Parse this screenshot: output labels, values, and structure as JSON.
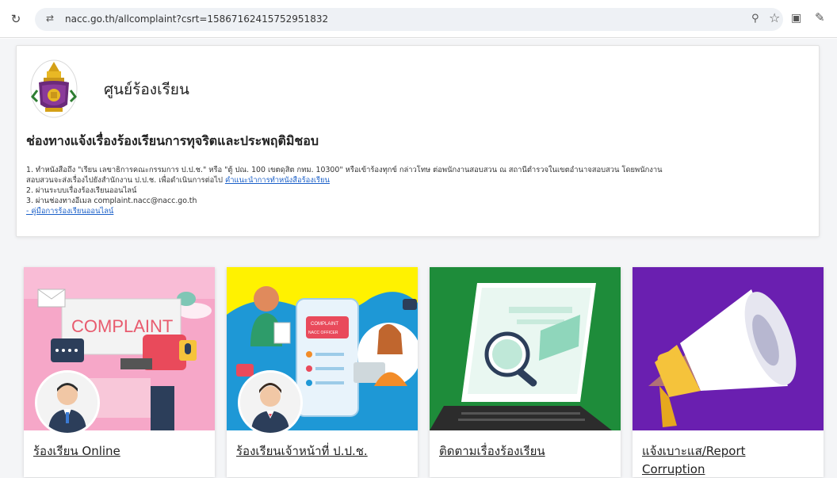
{
  "browser": {
    "url": "nacc.go.th/allcomplaint?csrt=15867162415752951832"
  },
  "header": {
    "center_title": "ศูนย์ร้องเรียน",
    "heading": "ช่องทางแจ้งเรื่องร้องเรียนการทุจริตและประพฤติมิชอบ"
  },
  "info": {
    "line1": "1. ทำหนังสือถึง \"เรียน เลขาธิการคณะกรรมการ ป.ป.ช.\" หรือ \"ตู้ ปณ. 100 เขตดุสิต กทม. 10300\" หรือเข้าร้องทุกข์ กล่าวโทษ ต่อพนักงานสอบสวน ณ สถานีตำรวจในเขตอำนาจสอบสวน โดยพนักงาน",
    "line2_prefix": "สอบสวนจะส่งเรื่องไปยังสำนักงาน ป.ป.ช. เพื่อดำเนินการต่อไป",
    "line2_link": "คำแนะนำการทำหนังสือร้องเรียน",
    "line3": "2. ผ่านระบบเรื่องร้องเรียนออนไลน์",
    "line4": "3. ผ่านช่องทางอีเมล complaint.nacc@nacc.go.th",
    "manual_link": "- คู่มือการร้องเรียนออนไลน์"
  },
  "tiles": [
    {
      "label": "ร้องเรียน Online",
      "art_text": "COMPLAINT",
      "bg": "#f6a7c8"
    },
    {
      "label": "ร้องเรียนเจ้าหน้าที่ ป.ป.ช.",
      "art_text_1": "COMPLAINT",
      "art_text_2": "NACC OFFICER",
      "bg": "#fff200"
    },
    {
      "label": "ติดตามเรื่องร้องเรียน",
      "bg": "#1e8c3a"
    },
    {
      "label": "แจ้งเบาะแส/Report",
      "label2": "Corruption",
      "bg": "#6a1fb0"
    }
  ]
}
